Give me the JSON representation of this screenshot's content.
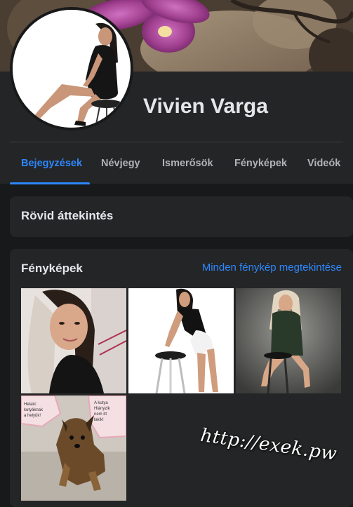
{
  "profile": {
    "name": "Vivien Varga"
  },
  "tabs": [
    {
      "label": "Bejegyzések",
      "active": true
    },
    {
      "label": "Névjegy",
      "active": false
    },
    {
      "label": "Ismerősök",
      "active": false
    },
    {
      "label": "Fényképek",
      "active": false
    },
    {
      "label": "Videók",
      "active": false
    }
  ],
  "intro": {
    "title": "Rövid áttekintés"
  },
  "photos": {
    "title": "Fényképek",
    "see_all": "Minden fénykép megtekintése",
    "card_text": "Hiányzik!!!! Már ...Budaörsön! ...plus kutyáknak... helyük!"
  },
  "watermark": "http://exek.pw",
  "colors": {
    "background": "#18191a",
    "panel": "#242526",
    "accent": "#2d88ff",
    "text_primary": "#e4e6eb",
    "text_secondary": "#b0b3b8"
  }
}
